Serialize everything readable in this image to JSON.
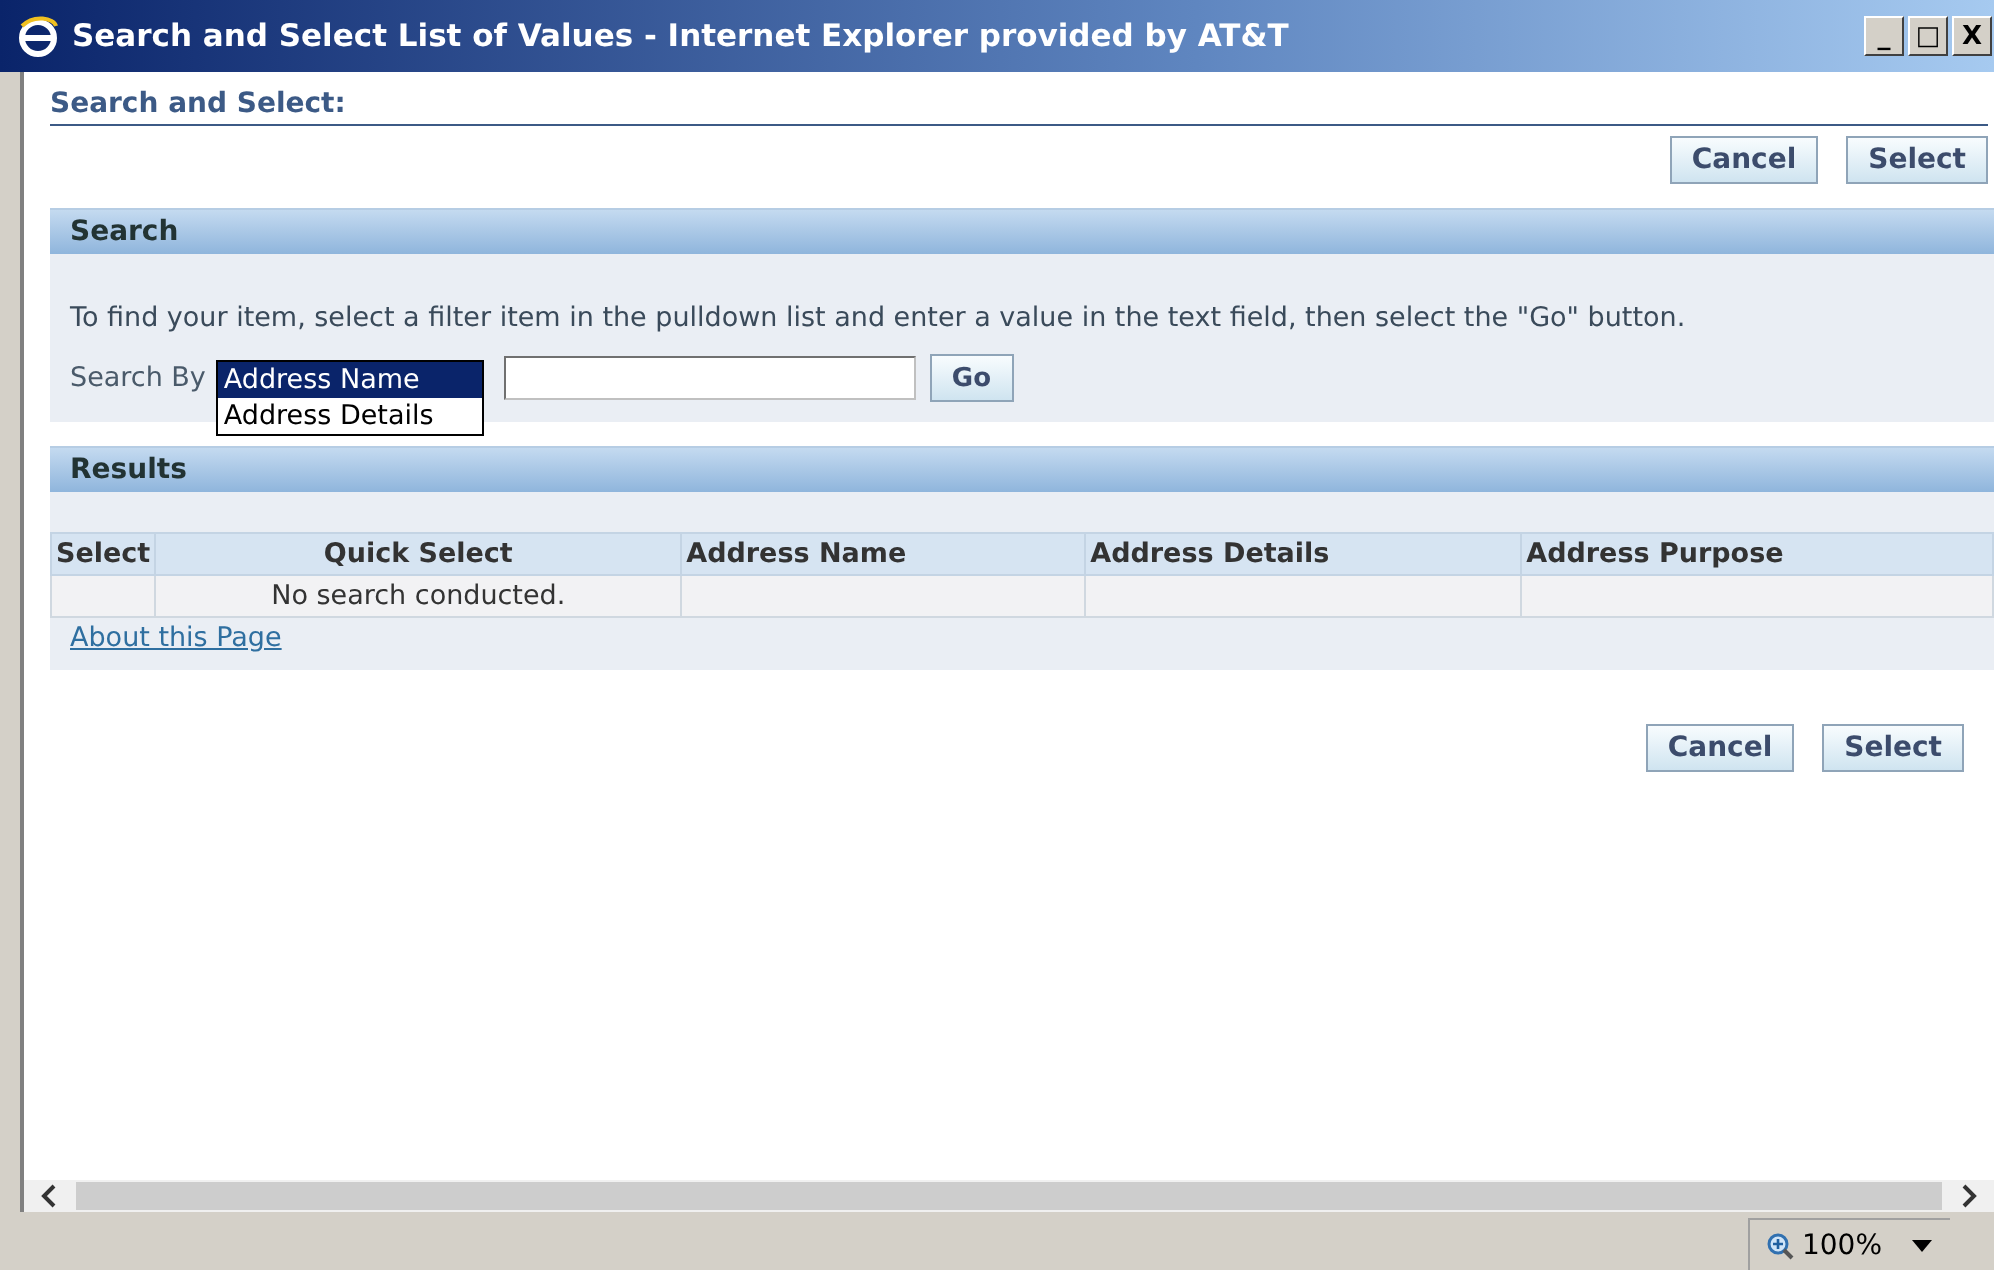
{
  "window": {
    "title": "Search and Select List of Values - Internet Explorer provided by AT&T",
    "controls": [
      "_",
      "□",
      "X"
    ]
  },
  "page_title": "Search and Select:",
  "top_buttons": [
    "Cancel",
    "Select"
  ],
  "search": {
    "heading": "Search",
    "instructions": "To find your item, select a filter item in the pulldown list and enter a value in the text field, then select the \"Go\" button.",
    "label": "Search By",
    "options": [
      {
        "label": "Address Name",
        "selected": true
      },
      {
        "label": "Address Details",
        "selected": false
      }
    ],
    "go": "Go"
  },
  "results": {
    "heading": "Results",
    "columns": [
      "Select",
      "Quick Select",
      "Address Name",
      "Address Details",
      "Address Purpose"
    ],
    "empty_message": "No search conducted.",
    "link": "About this Page"
  },
  "bottom_buttons": [
    "Cancel",
    "Select"
  ],
  "status_bar": {
    "zoom": "100%"
  }
}
